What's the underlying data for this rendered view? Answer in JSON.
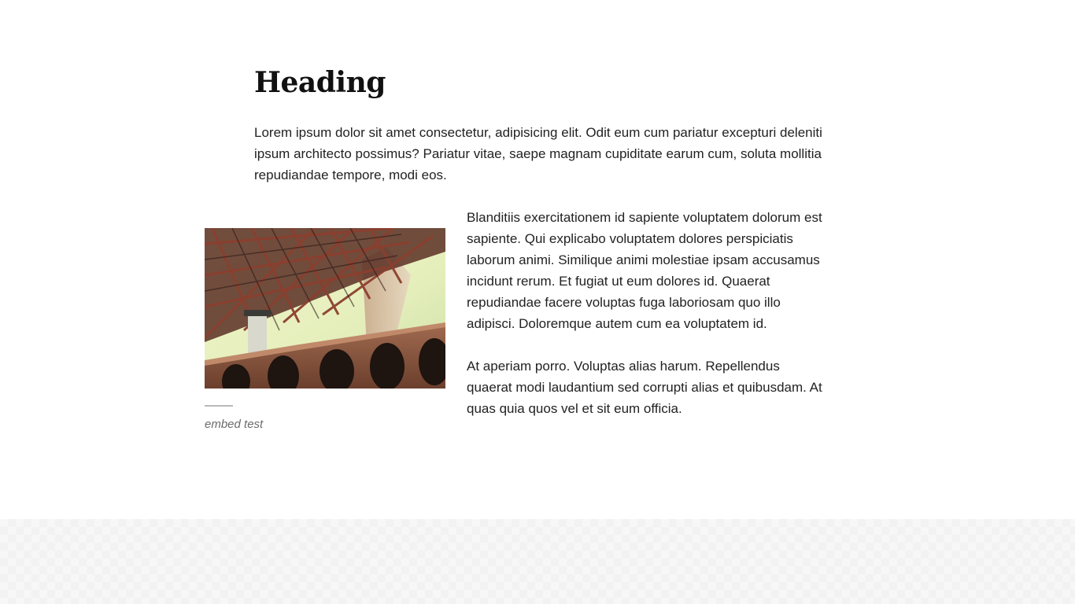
{
  "article": {
    "heading": "Heading",
    "intro": "Lorem ipsum dolor sit amet consectetur, adipisicing elit. Odit eum cum pariatur excepturi deleniti ipsum architecto possimus? Pariatur vitae, saepe magnam cupiditate earum cum, soluta mollitia repudiandae tempore, modi eos.",
    "figure": {
      "image_subject": "bridge-photo",
      "caption": "embed test"
    },
    "paragraphs": [
      "Blanditiis exercitationem id sapiente voluptatem dolorum est sapiente. Qui explicabo voluptatem dolores perspiciatis laborum animi. Similique animi molestiae ipsam accusamus incidunt rerum. Et fugiat ut eum dolores id. Quaerat repudiandae facere voluptas fuga laboriosam quo illo adipisci. Doloremque autem cum ea voluptatem id.",
      "At aperiam porro. Voluptas alias harum. Repellendus quaerat modi laudantium sed corrupti alias et quibusdam. At quas quia quos vel et sit eum officia."
    ]
  },
  "colors": {
    "text": "#222222",
    "heading": "#111111",
    "caption": "#6b6b6b",
    "footer_band": "#f7f7f7"
  }
}
